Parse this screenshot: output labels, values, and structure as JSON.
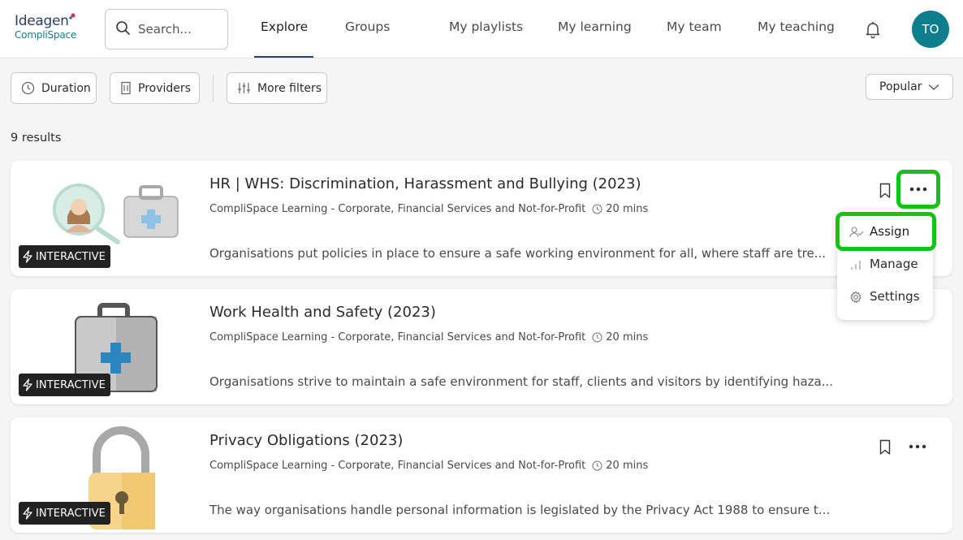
{
  "header": {
    "logo_line1": "Ideagen",
    "logo_line2": "CompliSpace",
    "search_placeholder": "Search...",
    "nav": [
      "Explore",
      "Groups",
      "My playlists",
      "My learning",
      "My team",
      "My teaching"
    ],
    "active_nav": "Explore",
    "avatar_initials": "TO",
    "accent_color": "#0e7e8d"
  },
  "filters": {
    "duration_label": "Duration",
    "providers_label": "Providers",
    "more_filters_label": "More filters",
    "sort_label": "Popular"
  },
  "results_label": "9 results",
  "cards": [
    {
      "title": "HR | WHS: Discrimination, Harassment and Bullying (2023)",
      "provider": "CompliSpace Learning - Corporate, Financial Services and Not-for-Profit",
      "duration": "20 mins",
      "description": "Organisations put policies in place to ensure a safe working environment for all, where staff are tre...",
      "badge": "INTERACTIVE",
      "thumbnail": "woman-magnifier-and-first-aid-kit"
    },
    {
      "title": "Work Health and Safety (2023)",
      "provider": "CompliSpace Learning - Corporate, Financial Services and Not-for-Profit",
      "duration": "20 mins",
      "description": "Organisations strive to maintain a safe environment for staff, clients and visitors by identifying haza...",
      "badge": "INTERACTIVE",
      "thumbnail": "first-aid-kit"
    },
    {
      "title": "Privacy Obligations (2023)",
      "provider": "CompliSpace Learning - Corporate, Financial Services and Not-for-Profit",
      "duration": "20 mins",
      "description": "The way organisations handle personal information is legislated by the Privacy Act 1988 to ensure t...",
      "badge": "INTERACTIVE",
      "thumbnail": "padlock"
    }
  ],
  "menu": {
    "assign": "Assign",
    "manage": "Manage",
    "settings": "Settings"
  },
  "highlight_color": "#17c217"
}
